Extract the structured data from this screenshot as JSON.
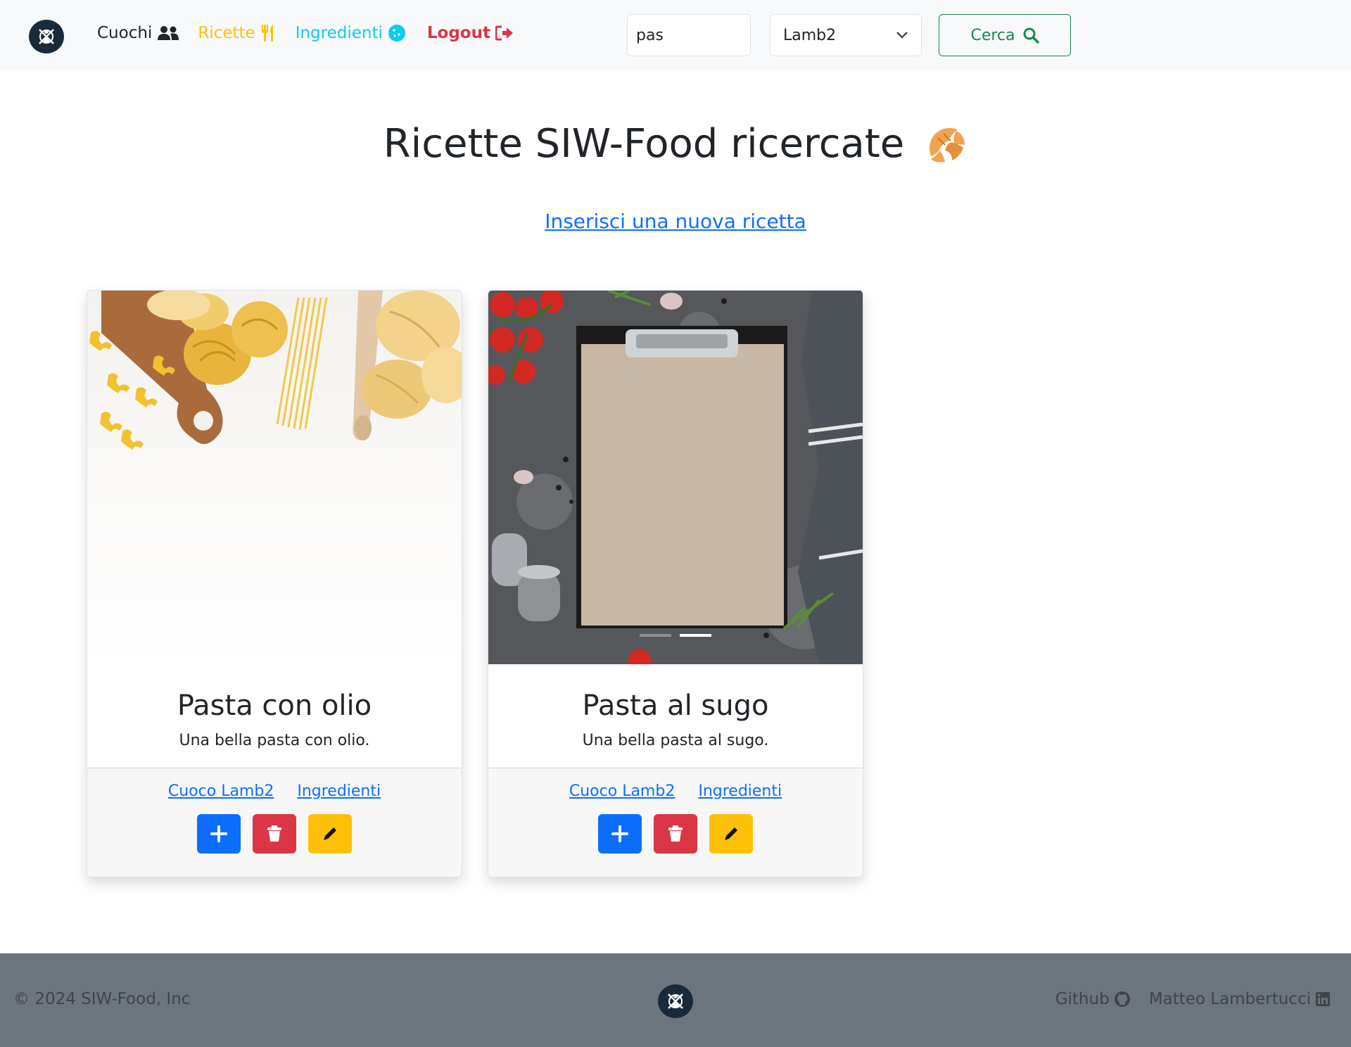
{
  "nav": {
    "links": [
      {
        "label": "Cuochi",
        "icon": "users-icon",
        "color": "#212529"
      },
      {
        "label": "Ricette",
        "icon": "utensils-icon",
        "color": "#ffc107"
      },
      {
        "label": "Ingredienti",
        "icon": "cookie-icon",
        "color": "#0dcaf0"
      },
      {
        "label": "Logout",
        "icon": "logout-icon",
        "color": "#dc3545"
      }
    ],
    "search": {
      "value": "pas"
    },
    "select": {
      "selected": "Lamb2"
    },
    "search_button": {
      "label": "Cerca",
      "icon": "search-icon",
      "color": "#198754"
    }
  },
  "main": {
    "title": "Ricette SIW-Food ricercate",
    "title_icon": "croissant-icon",
    "new_recipe_link": "Inserisci una nuova ricetta",
    "cards": [
      {
        "title": "Pasta con olio",
        "description": "Una bella pasta con olio.",
        "cook_link": "Cuoco Lamb2",
        "ingredients_link": "Ingredienti",
        "image": "pasta-ingredients-photo"
      },
      {
        "title": "Pasta al sugo",
        "description": "Una bella pasta al sugo.",
        "cook_link": "Cuoco Lamb2",
        "ingredients_link": "Ingredienti",
        "image": "clipboard-kitchen-photo"
      }
    ],
    "action_colors": {
      "add": "#0d6efd",
      "delete": "#dc3545",
      "edit": "#ffc107"
    }
  },
  "footer": {
    "copyright": "© 2024 SIW-Food, Inc",
    "links": [
      {
        "label": "Github",
        "icon": "github-icon"
      },
      {
        "label": "Matteo Lambertucci",
        "icon": "linkedin-icon"
      }
    ]
  }
}
